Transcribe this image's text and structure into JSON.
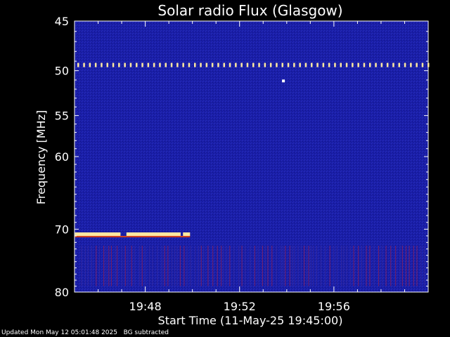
{
  "chart_data": {
    "type": "heatmap",
    "title": "Solar radio Flux (Glasgow)",
    "xlabel": "Start Time (11-May-25 19:45:00)",
    "ylabel": "Frequency [MHz]",
    "x_range": [
      "19:45:00",
      "20:00:00"
    ],
    "xlim_minutes": [
      0,
      15
    ],
    "ylim": [
      45,
      80
    ],
    "y_scale": "log",
    "x_ticks": [
      "19:48",
      "19:52",
      "19:56"
    ],
    "x_tick_minutes": [
      3,
      7,
      11
    ],
    "y_ticks": [
      45,
      50,
      55,
      60,
      70,
      80
    ],
    "background_color": "#1a1ea8",
    "features": [
      {
        "frequency_mhz": 49.4,
        "start_minute": 0.0,
        "end_minute": 15.0,
        "kind": "dashed narrowband interference"
      },
      {
        "frequency_mhz": 51.1,
        "start_minute": 8.8,
        "end_minute": 8.9,
        "kind": "point"
      },
      {
        "frequency_mhz": 70.8,
        "start_minute": 0.0,
        "end_minute": 4.9,
        "kind": "bright narrowband interference"
      },
      {
        "frequency_mhz_range": [
          72.5,
          79
        ],
        "start_minute": 0.3,
        "end_minute": 15.0,
        "kind": "vertical streaks"
      }
    ]
  },
  "footer": {
    "updated": "Updated Mon May 12 05:01:48 2025",
    "bg_note": "BG subtracted"
  },
  "colors": {
    "plot_bg": "#1a1ea8",
    "interference": "#ffe8a0",
    "streak": "#a0204a"
  }
}
